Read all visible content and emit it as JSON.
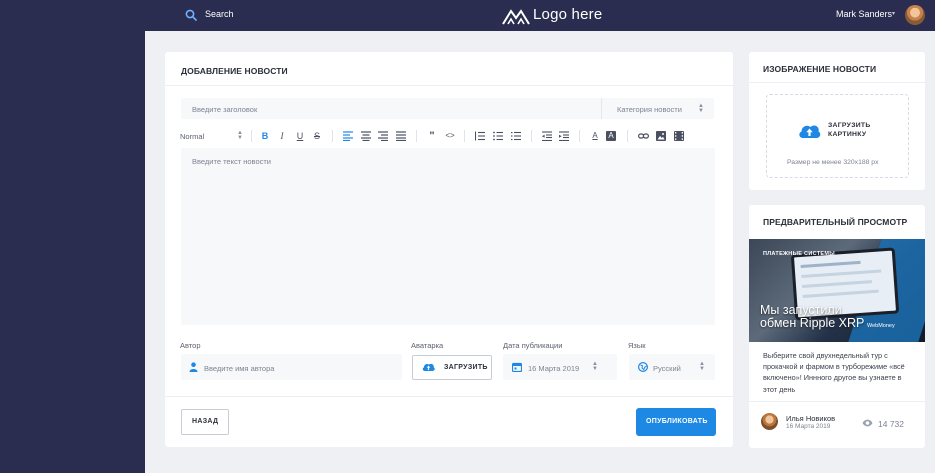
{
  "header": {
    "search_label": "Search",
    "logo_text": "Logo here",
    "user_name": "Mark Sanders",
    "user_caret": "▾"
  },
  "editor": {
    "title": "ДОБАВЛЕНИЕ НОВОСТИ",
    "headline_placeholder": "Введите заголовок",
    "category_placeholder": "Категория новости",
    "format_value": "Normal",
    "body_placeholder": "Введите текст новости",
    "toolbar_icons": [
      "bold-icon",
      "italic-icon",
      "underline-icon",
      "strikethrough-icon",
      "align-left-icon",
      "align-center-icon",
      "align-right-icon",
      "align-justify-icon",
      "quote-icon",
      "code-icon",
      "ordered-list-icon",
      "numbered-list-icon",
      "bullet-list-icon",
      "outdent-icon",
      "indent-icon",
      "text-color-icon",
      "highlight-icon",
      "link-icon",
      "image-icon",
      "video-icon"
    ],
    "author_label": "Автор",
    "author_placeholder": "Введите имя автора",
    "avatar_label": "Аватарка",
    "upload_label": "ЗАГРУЗИТЬ",
    "date_label": "Дата публикации",
    "date_value": "16 Марта 2019",
    "language_label": "Язык",
    "language_value": "Русский",
    "back_label": "НАЗАД",
    "publish_label": "ОПУБЛИКОВАТЬ",
    "accent_color": "#1e88e5"
  },
  "news_image": {
    "title": "ИЗОБРАЖЕНИЕ НОВОСТИ",
    "upload_line1": "ЗАГРУЗИТЬ",
    "upload_line2": "КАРТИНКУ",
    "size_hint": "Размер не менее  320х188 px"
  },
  "preview": {
    "title": "ПРЕДВАРИТЕЛЬНЫЙ ПРОСМОТР",
    "image_tag": "ПЛАТЕЖНЫЕ СИСТЕМЫ",
    "image_headline_1": "Мы запустили",
    "image_headline_2": "обмен Ripple XRP",
    "image_watermark": "WebMoney",
    "description": "Выберите свой двухнедельный тур с прокачкой и фармом в турборежиме «всё включено»! Иннного другое вы узнаете в этот день",
    "author_name": "Илья Новиков",
    "author_date": "16 Марта 2019",
    "views": "14 732"
  }
}
